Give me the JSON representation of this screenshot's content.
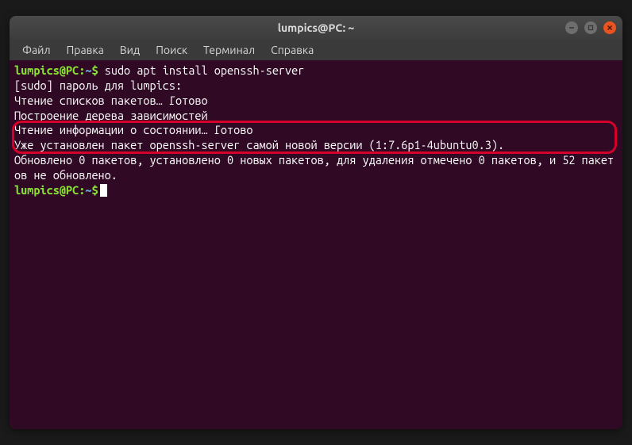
{
  "titlebar": {
    "title": "lumpics@PC: ~"
  },
  "menu": {
    "file": "Файл",
    "edit": "Правка",
    "view": "Вид",
    "search": "Поиск",
    "terminal": "Терминал",
    "help": "Справка"
  },
  "terminal": {
    "prompt_user": "lumpics@PC",
    "prompt_sep": ":",
    "prompt_tilde": "~",
    "prompt_dollar": "$",
    "command1": " sudo apt install openssh-server",
    "line2": "[sudo] пароль для lumpics:",
    "line3": "Чтение списков пакетов… Готово",
    "line4": "Построение дерева зависимостей",
    "line5": "Чтение информации о состоянии… Готово",
    "line6": "Уже установлен пакет openssh-server самой новой версии (1:7.6p1-4ubuntu0.3).",
    "line7": "Обновлено 0 пакетов, установлено 0 новых пакетов, для удаления отмечено 0 пакетов, и 52 пакетов не обновлено."
  }
}
